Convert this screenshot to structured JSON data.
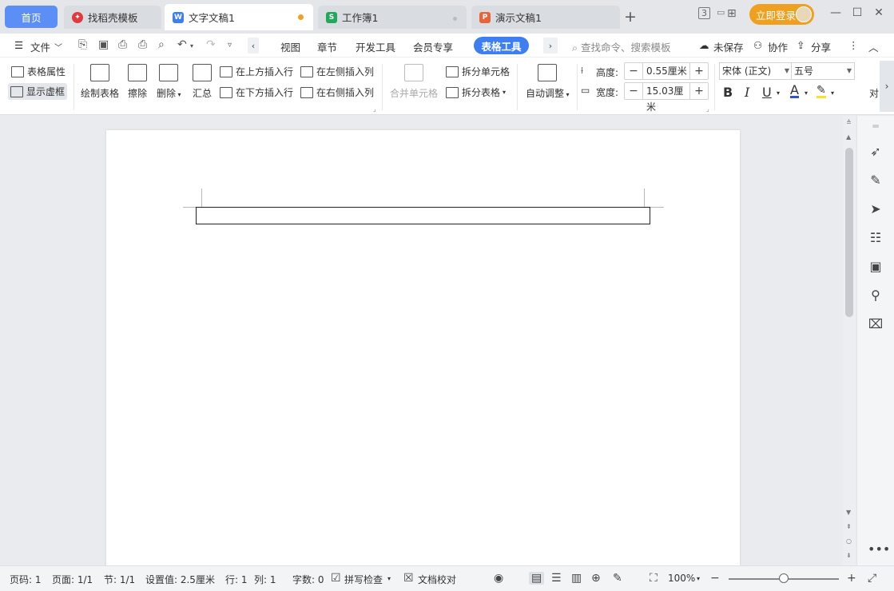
{
  "tabs": {
    "home": "首页",
    "items": [
      {
        "label": "找稻壳模板",
        "icon_letter": "",
        "icon_color": "#e0393e",
        "state": "inactive"
      },
      {
        "label": "文字文稿1",
        "icon_letter": "W",
        "icon_color": "#3d7ff3",
        "state": "active",
        "dot_color": "#f0a020"
      },
      {
        "label": "工作簿1",
        "icon_letter": "S",
        "icon_color": "#22a85a",
        "state": "inactive",
        "dot_color": "#b8bcc2"
      },
      {
        "label": "演示文稿1",
        "icon_letter": "P",
        "icon_color": "#e8623a",
        "state": "inactive"
      }
    ],
    "add": "+",
    "login": "立即登录",
    "badge": "3"
  },
  "menu": {
    "file": "文件",
    "items": [
      "视图",
      "章节",
      "开发工具",
      "会员专享"
    ],
    "active_tool": "表格工具",
    "search_placeholder": "查找命令、搜索模板",
    "unsaved": "未保存",
    "collab": "协作",
    "share": "分享"
  },
  "ribbon": {
    "table_props": "表格属性",
    "show_grid": "显示虚框",
    "draw_table": "绘制表格",
    "erase": "擦除",
    "delete": "删除",
    "summary": "汇总",
    "insert_above": "在上方插入行",
    "insert_below": "在下方插入行",
    "insert_left": "在左侧插入列",
    "insert_right": "在右侧插入列",
    "merge_cells": "合并单元格",
    "split_cells": "拆分单元格",
    "split_table": "拆分表格",
    "auto_adjust": "自动调整",
    "height_label": "高度:",
    "height_value": "0.55厘米",
    "width_label": "宽度:",
    "width_value": "15.03厘米",
    "font_name": "宋体 (正文)",
    "font_size": "五号",
    "bold": "B",
    "italic": "I",
    "underline": "U",
    "font_color_letter": "A",
    "align_label": "对"
  },
  "status": {
    "page_no": "页码: 1",
    "pages": "页面: 1/1",
    "section": "节: 1/1",
    "setting": "设置值: 2.5厘米",
    "row": "行: 1",
    "col": "列: 1",
    "word_count": "字数: 0",
    "spell_check": "拼写检查",
    "doc_check": "文档校对",
    "zoom": "100%",
    "zoom_fraction": 0.5
  },
  "colors": {
    "accent": "#3d7ff3",
    "login": "#f0a020",
    "home_tab": "#5b8ff5"
  }
}
